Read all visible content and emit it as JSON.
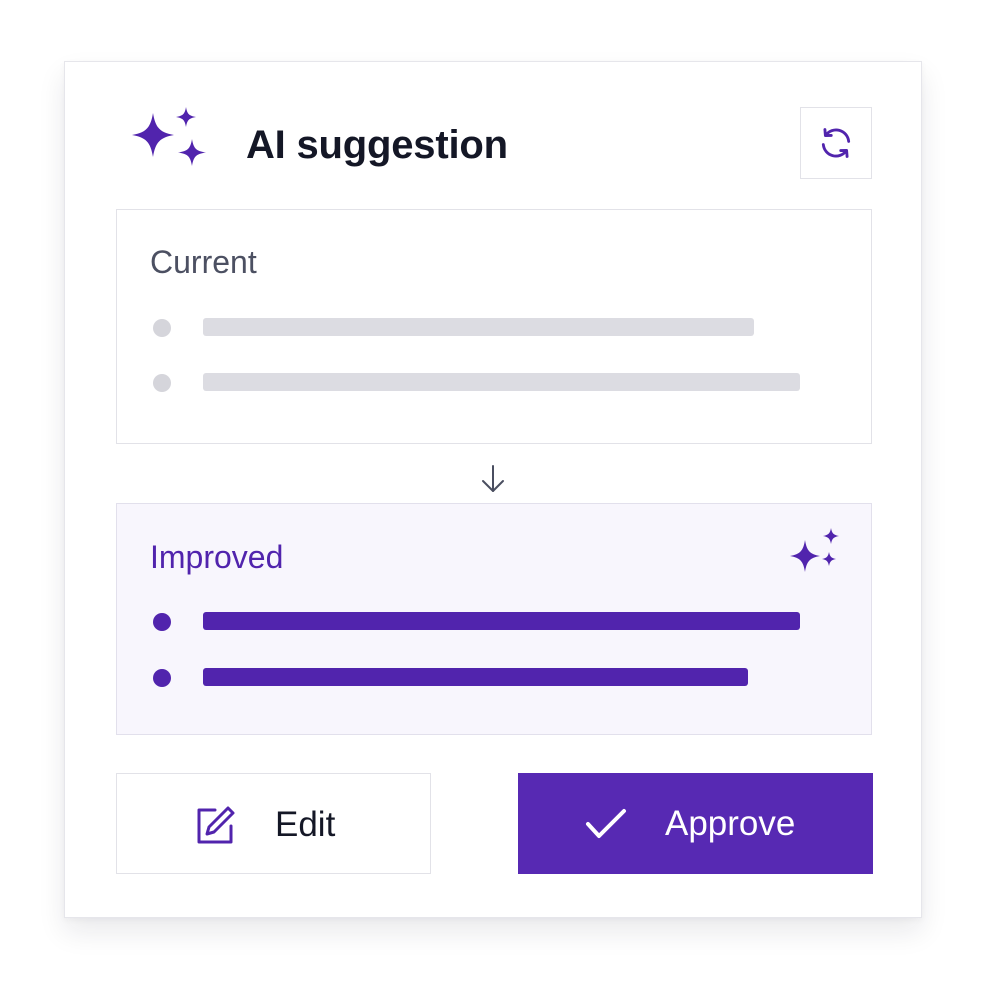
{
  "header": {
    "title": "AI suggestion",
    "sparkle_icon": "sparkles-icon",
    "refresh_icon": "refresh-icon"
  },
  "current": {
    "label": "Current",
    "placeholder_lines": 2
  },
  "transition_icon": "arrow-down-icon",
  "improved": {
    "label": "Improved",
    "sparkle_icon": "sparkles-icon",
    "placeholder_lines": 2
  },
  "actions": {
    "edit_label": "Edit",
    "edit_icon": "edit-icon",
    "approve_label": "Approve",
    "approve_icon": "check-icon"
  },
  "colors": {
    "accent": "#5729b3",
    "accent_text": "#5124ad",
    "title_text": "#141726",
    "placeholder_gray": "#dcdce2",
    "improved_bg": "#f8f6fd"
  }
}
